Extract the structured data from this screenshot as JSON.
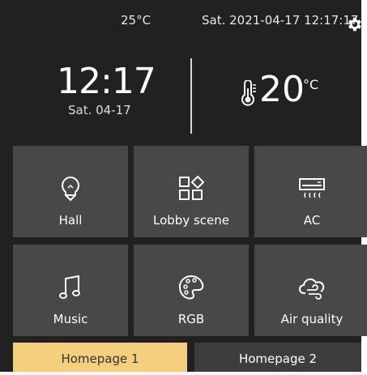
{
  "status": {
    "outdoor_temp": "25°C",
    "datetime": "Sat. 2021-04-17 12:17:17"
  },
  "header": {
    "time": "12:17",
    "date": "Sat. 04-17",
    "room_temp": "20",
    "room_temp_unit": "°C"
  },
  "tiles": [
    {
      "label": "Hall",
      "icon": "bulb-icon"
    },
    {
      "label": "Lobby scene",
      "icon": "scene-grid-icon"
    },
    {
      "label": "AC",
      "icon": "air-conditioner-icon"
    },
    {
      "label": "Music",
      "icon": "music-note-icon"
    },
    {
      "label": "RGB",
      "icon": "palette-icon"
    },
    {
      "label": "Air quality",
      "icon": "cloud-wind-icon"
    }
  ],
  "tabs": [
    {
      "label": "Homepage 1",
      "active": true
    },
    {
      "label": "Homepage 2",
      "active": false
    }
  ],
  "colors": {
    "background": "#212121",
    "tile": "#484848",
    "active_tab": "#f4cf7e",
    "inactive_tab": "#3d3d3d"
  }
}
